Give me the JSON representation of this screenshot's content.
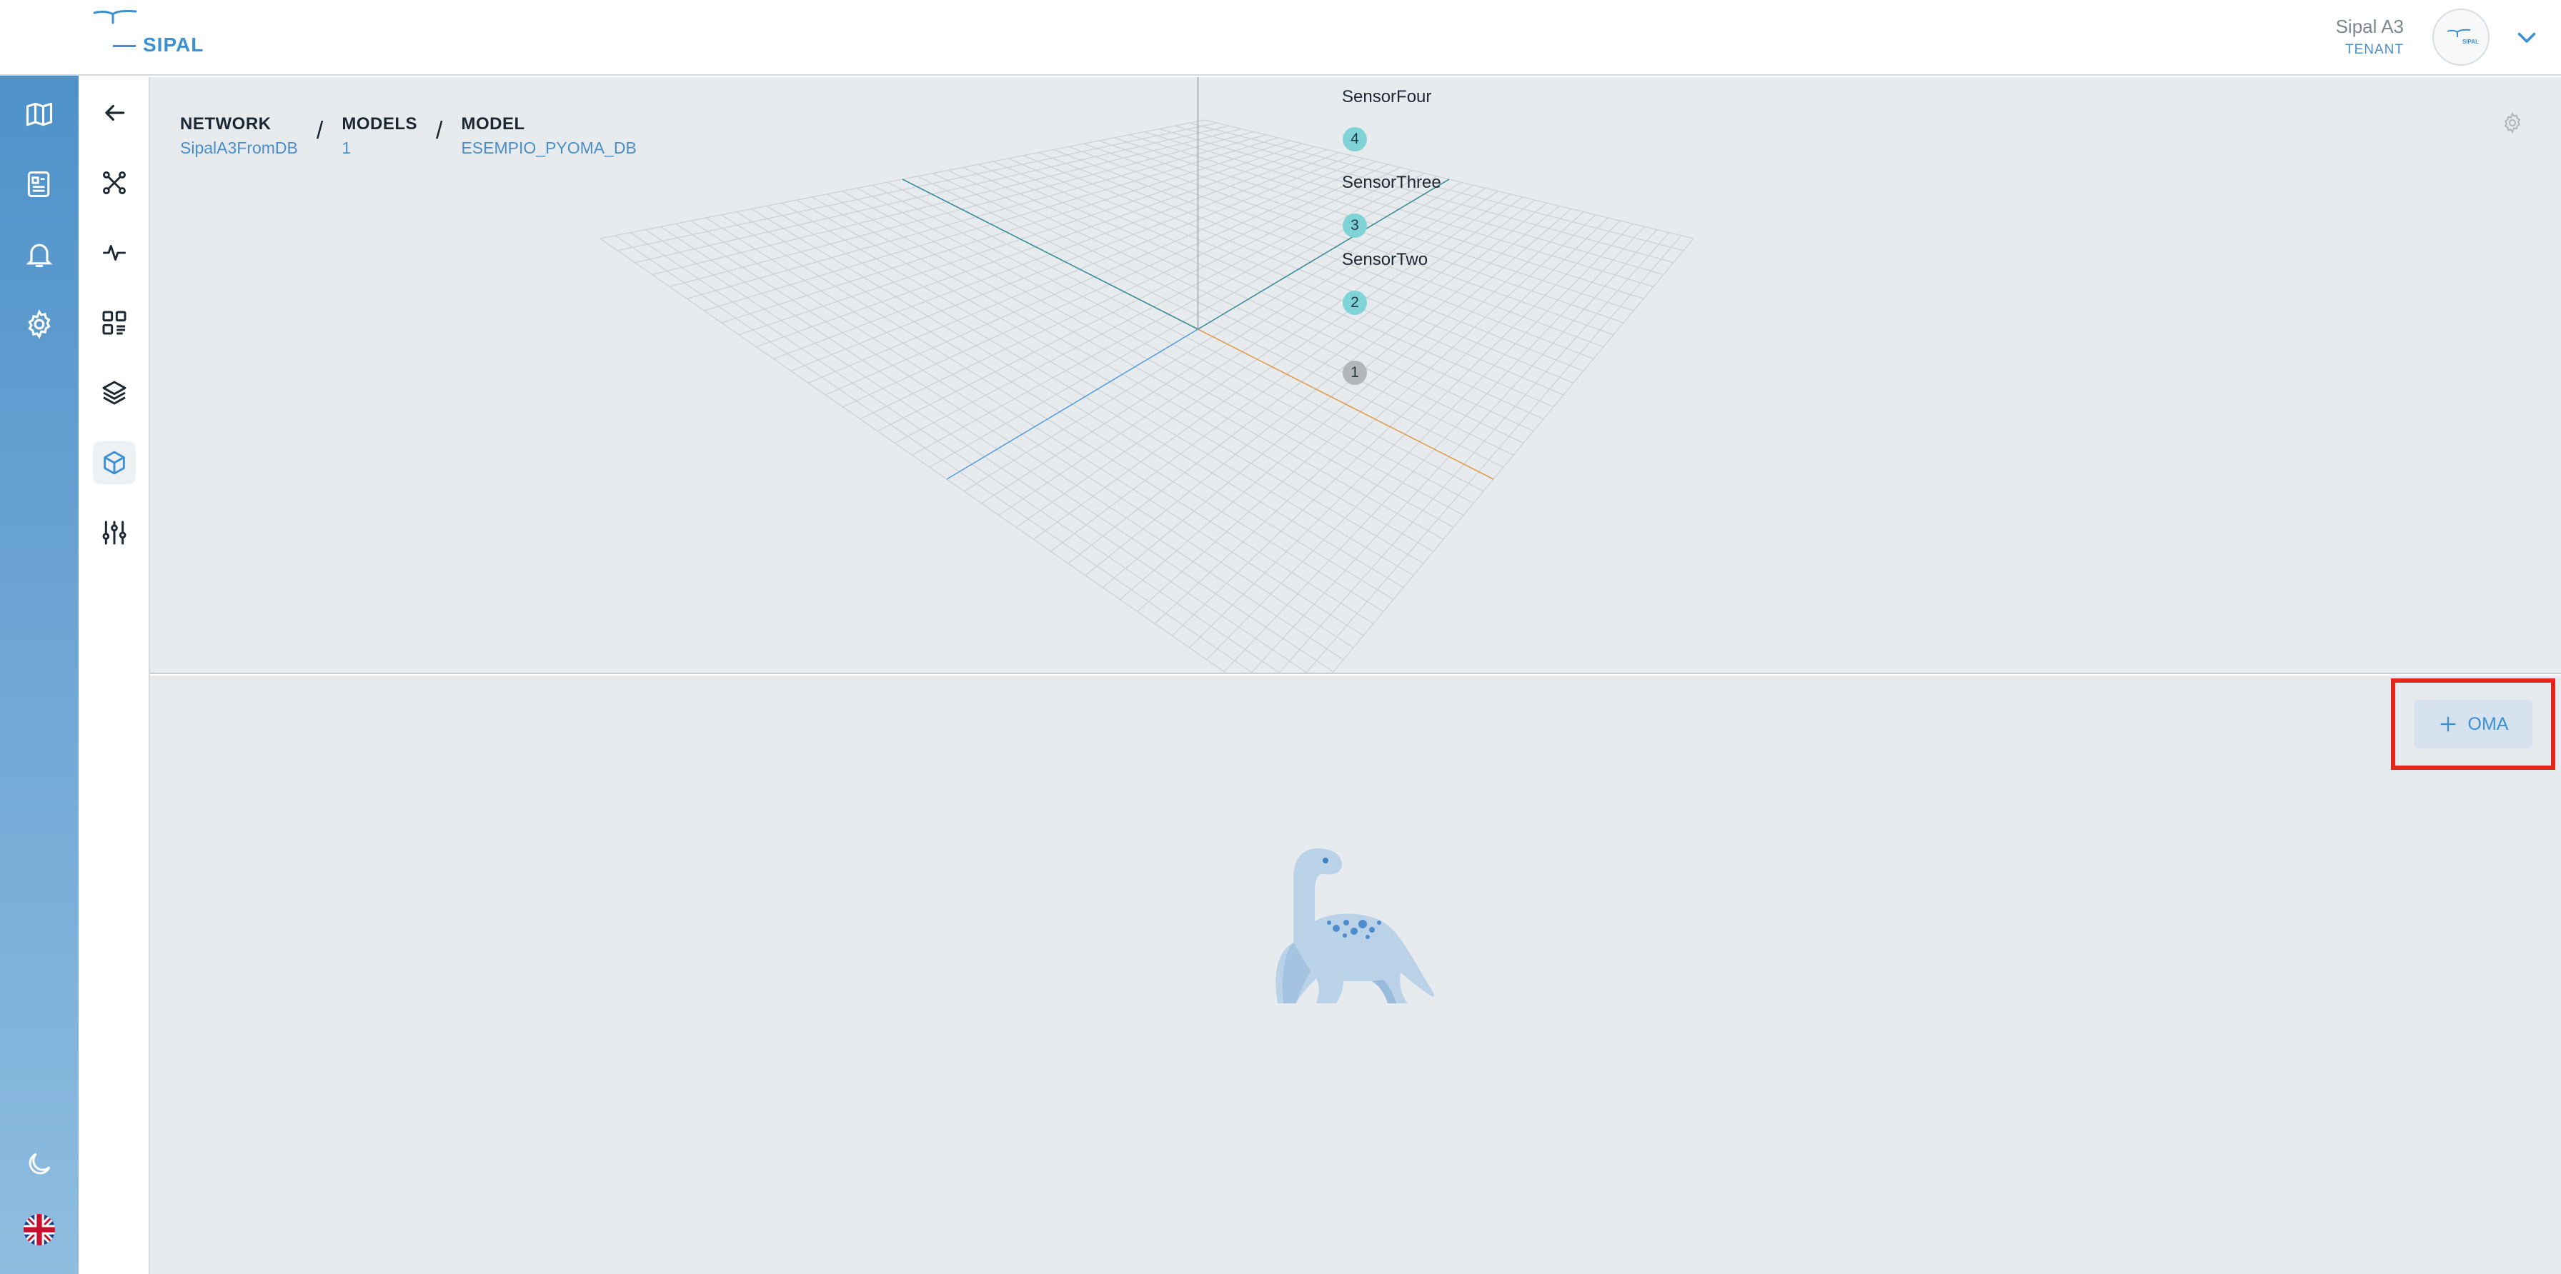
{
  "brand": {
    "logo_text": "SIPAL",
    "avatar_text": "SIPAL"
  },
  "user": {
    "name": "Sipal A3",
    "role": "TENANT"
  },
  "rail": {
    "items": [
      {
        "icon": "map-icon",
        "label": "Map"
      },
      {
        "icon": "report-icon",
        "label": "Reports"
      },
      {
        "icon": "bell-icon",
        "label": "Alarms"
      },
      {
        "icon": "gear-icon",
        "label": "Settings"
      }
    ],
    "bottom": [
      {
        "icon": "moon-icon",
        "label": "Dark mode"
      },
      {
        "icon": "uk-flag-icon",
        "label": "Language"
      }
    ]
  },
  "subnav": {
    "items": [
      {
        "icon": "back-arrow-icon",
        "active": false
      },
      {
        "icon": "network-icon",
        "active": false
      },
      {
        "icon": "pulse-icon",
        "active": false
      },
      {
        "icon": "dashboard-icon",
        "active": false
      },
      {
        "icon": "layers-icon",
        "active": false
      },
      {
        "icon": "cube-icon",
        "active": true
      },
      {
        "icon": "sliders-icon",
        "active": false
      }
    ]
  },
  "breadcrumb": [
    {
      "title": "NETWORK",
      "value": "SipalA3FromDB"
    },
    {
      "title": "MODELS",
      "value": "1"
    },
    {
      "title": "MODEL",
      "value": "ESEMPIO_PYOMA_DB"
    }
  ],
  "viewer": {
    "sensors": [
      {
        "id": "4",
        "label": "SensorFour",
        "color": "#7fd3d6"
      },
      {
        "id": "3",
        "label": "SensorThree",
        "color": "#7fd3d6"
      },
      {
        "id": "2",
        "label": "SensorTwo",
        "color": "#7fd3d6"
      },
      {
        "id": "1",
        "label": "",
        "color": "#b3b6b9"
      }
    ],
    "axis_colors": {
      "x": "#e0a050",
      "y": "#5aa0e0",
      "z": "#3a8f9a"
    }
  },
  "panel": {
    "add_button_label": "OMA",
    "add_button_icon": "plus-icon",
    "empty_state_icon": "dinosaur-illustration"
  },
  "colors": {
    "accent": "#3b8fd4",
    "rail_top": "#4a8fc8",
    "highlight": "#e4261c"
  }
}
